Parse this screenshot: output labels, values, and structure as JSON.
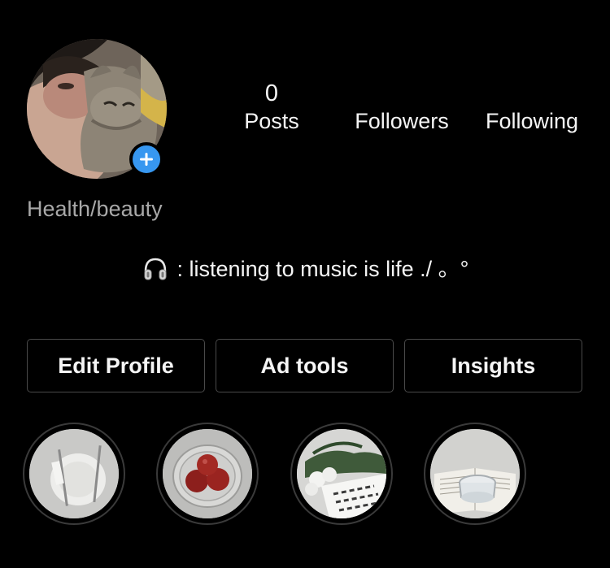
{
  "profile": {
    "category": "Health/beauty",
    "bio_text": ": listening to music is life ./ 。°",
    "bio_icon": "headphones-icon"
  },
  "stats": {
    "posts": {
      "count": "0",
      "label": "Posts"
    },
    "followers": {
      "count": "",
      "label": "Followers"
    },
    "following": {
      "count": "",
      "label": "Following"
    }
  },
  "actions": {
    "edit_profile": "Edit Profile",
    "ad_tools": "Ad tools",
    "insights": "Insights"
  },
  "colors": {
    "background": "#000000",
    "text": "#f5f5f5",
    "secondary_text": "#a8a8a8",
    "accent": "#3797f0",
    "button_border": "#4a4a4a"
  }
}
